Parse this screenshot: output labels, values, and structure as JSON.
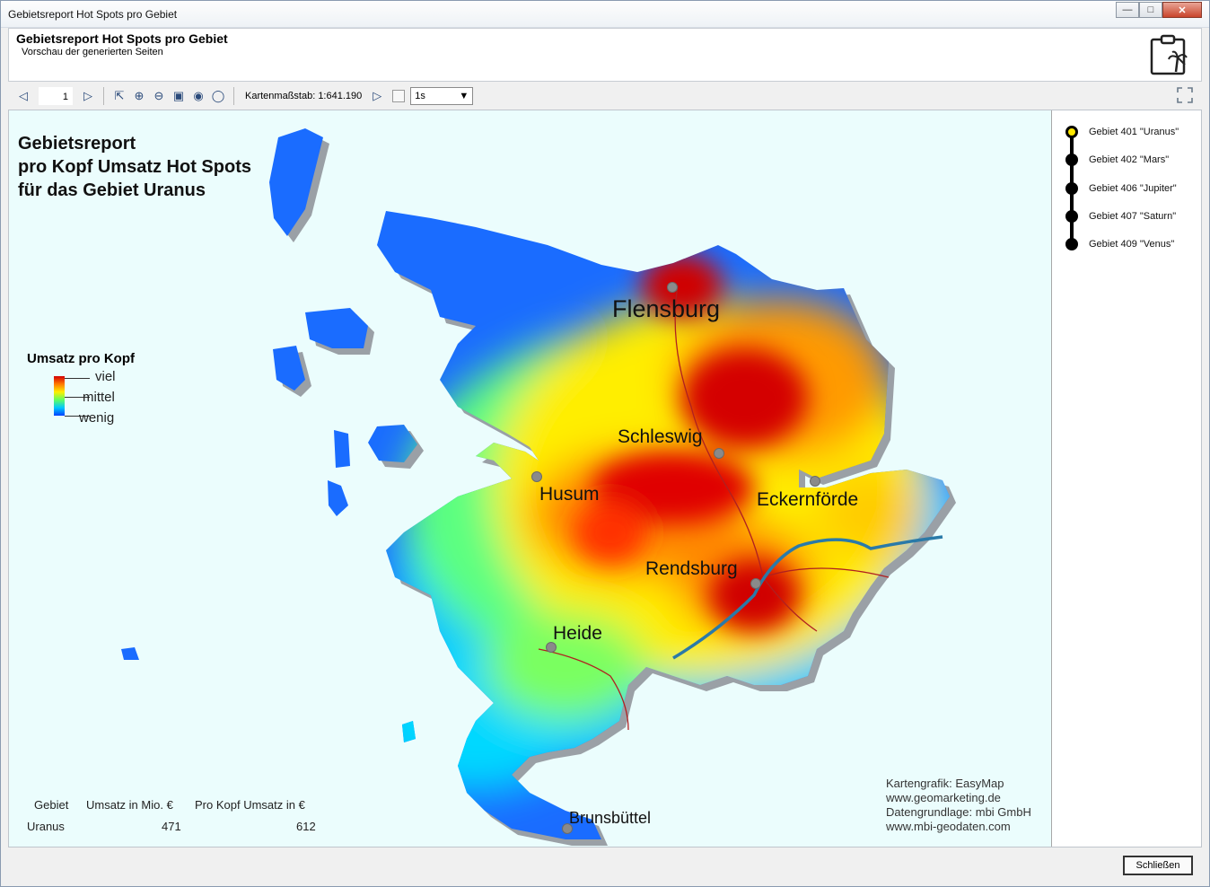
{
  "window": {
    "title": "Gebietsreport Hot Spots pro Gebiet"
  },
  "header": {
    "title": "Gebietsreport Hot Spots pro Gebiet",
    "subtitle": "Vorschau der generierten Seiten"
  },
  "toolbar": {
    "page": "1",
    "scale_label": "Kartenmaßstab: 1:641.190",
    "interval_value": "1s"
  },
  "map": {
    "title_lines": [
      "Gebietsreport",
      "pro Kopf Umsatz Hot Spots",
      "für das Gebiet Uranus"
    ],
    "legend": {
      "title": "Umsatz pro Kopf",
      "high": "viel",
      "mid": "mittel",
      "low": "wenig"
    },
    "cities": {
      "flensburg": "Flensburg",
      "schleswig": "Schleswig",
      "husum": "Husum",
      "eckernfoerde": "Eckernförde",
      "rendsburg": "Rendsburg",
      "heide": "Heide",
      "brunsbuettel": "Brunsbüttel"
    },
    "stats": {
      "h_gebiet": "Gebiet",
      "h_umsatz": "Umsatz in Mio. €",
      "h_prokopf": "Pro Kopf Umsatz in €",
      "gebiet": "Uranus",
      "umsatz": "471",
      "prokopf": "612"
    },
    "credits": [
      "Kartengrafik: EasyMap",
      "www.geomarketing.de",
      "Datengrundlage: mbi GmbH",
      "www.mbi-geodaten.com"
    ]
  },
  "sidebar": {
    "items": [
      {
        "label": "Gebiet 401 \"Uranus\""
      },
      {
        "label": "Gebiet 402 \"Mars\""
      },
      {
        "label": "Gebiet 406 \"Jupiter\""
      },
      {
        "label": "Gebiet 407 \"Saturn\""
      },
      {
        "label": "Gebiet 409 \"Venus\""
      }
    ]
  },
  "footer": {
    "close_label": "Schließen"
  },
  "colors": {
    "hot": "#d40000",
    "warm": "#ff8a00",
    "mid": "#ffee00",
    "cool": "#60ff60",
    "cold": "#00b8ff",
    "coldest": "#0030ff",
    "water": "#ebfdfd",
    "river": "#2a7aa8"
  }
}
